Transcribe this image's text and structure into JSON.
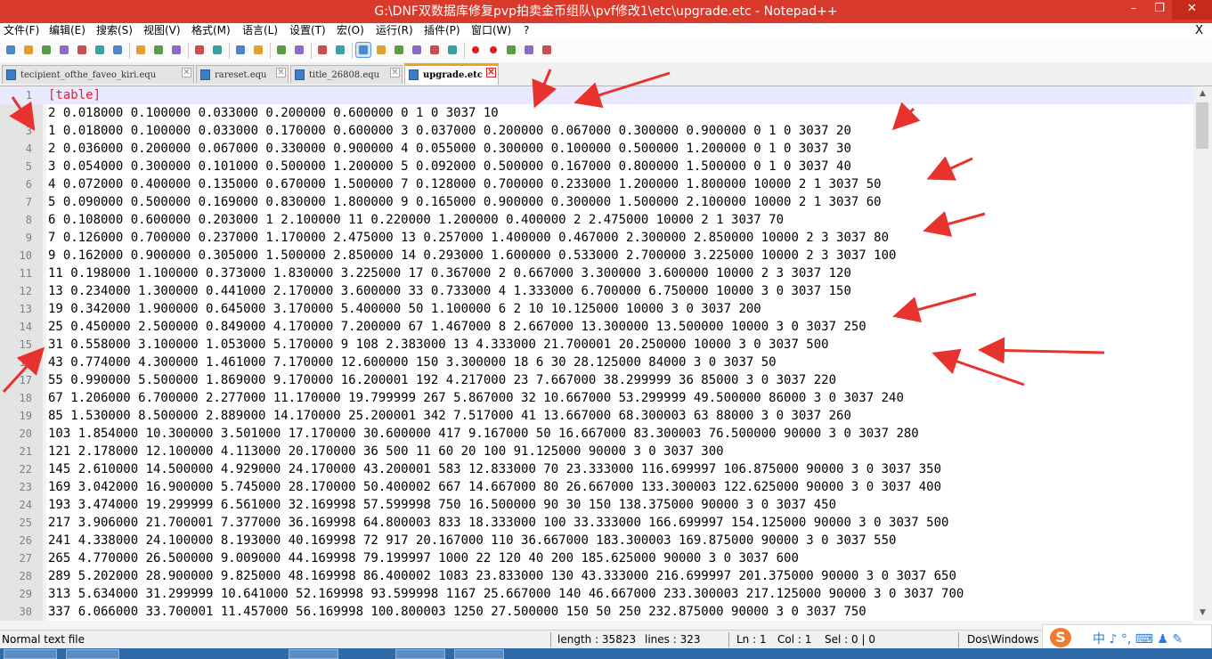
{
  "window": {
    "title": "G:\\DNF双数据库修复pvp拍卖金币组队\\pvf修改1\\etc\\upgrade.etc - Notepad++",
    "minimize_glyph": "–",
    "maximize_glyph": "❐",
    "close_glyph": "✕"
  },
  "menu": {
    "items": [
      "文件(F)",
      "编辑(E)",
      "搜索(S)",
      "视图(V)",
      "格式(M)",
      "语言(L)",
      "设置(T)",
      "宏(O)",
      "运行(R)",
      "插件(P)",
      "窗口(W)",
      "?"
    ],
    "close_glyph": "X"
  },
  "toolbar": {
    "icons": [
      "new-file-icon",
      "open-file-icon",
      "save-icon",
      "save-all-icon",
      "close-icon",
      "close-all-icon",
      "print-icon",
      "cut-icon",
      "copy-icon",
      "paste-icon",
      "undo-icon",
      "redo-icon",
      "find-icon",
      "replace-icon",
      "zoom-in-icon",
      "zoom-out-icon",
      "sync-vertical-icon",
      "sync-horizontal-icon",
      "word-wrap-icon",
      "show-all-chars-icon",
      "indent-guide-icon",
      "doc-map-icon",
      "function-list-icon",
      "folder-workspace-icon",
      "record-macro-icon",
      "stop-record-icon",
      "play-macro-icon",
      "run-macro-multiple-icon",
      "save-macro-icon"
    ]
  },
  "tabs": [
    {
      "label": "tecipient_ofthe_faveo_kiri.equ",
      "active": false
    },
    {
      "label": "rareset.equ",
      "active": false
    },
    {
      "label": "title_26808.equ",
      "active": false
    },
    {
      "label": "upgrade.etc",
      "active": true
    }
  ],
  "editor": {
    "lines": [
      {
        "n": "1",
        "text": "[table]",
        "section": true
      },
      {
        "n": "2",
        "text": "2 0.018000 0.100000 0.033000 0.200000 0.600000 0 1 0 3037 10"
      },
      {
        "n": "3",
        "text": "1 0.018000 0.100000 0.033000 0.170000 0.600000 3 0.037000 0.200000 0.067000 0.300000 0.900000 0 1 0 3037 20"
      },
      {
        "n": "4",
        "text": "2 0.036000 0.200000 0.067000 0.330000 0.900000 4 0.055000 0.300000 0.100000 0.500000 1.200000 0 1 0 3037 30"
      },
      {
        "n": "5",
        "text": "3 0.054000 0.300000 0.101000 0.500000 1.200000 5 0.092000 0.500000 0.167000 0.800000 1.500000 0 1 0 3037 40"
      },
      {
        "n": "6",
        "text": "4 0.072000 0.400000 0.135000 0.670000 1.500000 7 0.128000 0.700000 0.233000 1.200000 1.800000 10000 2 1 3037 50"
      },
      {
        "n": "7",
        "text": "5 0.090000 0.500000 0.169000 0.830000 1.800000 9 0.165000 0.900000 0.300000 1.500000 2.100000 10000 2 1 3037 60"
      },
      {
        "n": "8",
        "text": "6 0.108000 0.600000 0.203000 1 2.100000 11 0.220000 1.200000 0.400000 2 2.475000 10000 2 1 3037 70"
      },
      {
        "n": "9",
        "text": "7 0.126000 0.700000 0.237000 1.170000 2.475000 13 0.257000 1.400000 0.467000 2.300000 2.850000 10000 2 3 3037 80"
      },
      {
        "n": "10",
        "text": "9 0.162000 0.900000 0.305000 1.500000 2.850000 14 0.293000 1.600000 0.533000 2.700000 3.225000 10000 2 3 3037 100"
      },
      {
        "n": "11",
        "text": "11 0.198000 1.100000 0.373000 1.830000 3.225000 17 0.367000 2 0.667000 3.300000 3.600000 10000 2 3 3037 120"
      },
      {
        "n": "12",
        "text": "13 0.234000 1.300000 0.441000 2.170000 3.600000 33 0.733000 4 1.333000 6.700000 6.750000 10000 3 0 3037 150"
      },
      {
        "n": "13",
        "text": "19 0.342000 1.900000 0.645000 3.170000 5.400000 50 1.100000 6 2 10 10.125000 10000 3 0 3037 200"
      },
      {
        "n": "14",
        "text": "25 0.450000 2.500000 0.849000 4.170000 7.200000 67 1.467000 8 2.667000 13.300000 13.500000 10000 3 0 3037 250"
      },
      {
        "n": "15",
        "text": "31 0.558000 3.100000 1.053000 5.170000 9 108 2.383000 13 4.333000 21.700001 20.250000 10000 3 0 3037 500"
      },
      {
        "n": "16",
        "text": "43 0.774000 4.300000 1.461000 7.170000 12.600000 150 3.300000 18 6 30 28.125000 84000 3 0 3037 50"
      },
      {
        "n": "17",
        "text": "55 0.990000 5.500000 1.869000 9.170000 16.200001 192 4.217000 23 7.667000 38.299999 36 85000 3 0 3037 220"
      },
      {
        "n": "18",
        "text": "67 1.206000 6.700000 2.277000 11.170000 19.799999 267 5.867000 32 10.667000 53.299999 49.500000 86000 3 0 3037 240"
      },
      {
        "n": "19",
        "text": "85 1.530000 8.500000 2.889000 14.170000 25.200001 342 7.517000 41 13.667000 68.300003 63 88000 3 0 3037 260"
      },
      {
        "n": "20",
        "text": "103 1.854000 10.300000 3.501000 17.170000 30.600000 417 9.167000 50 16.667000 83.300003 76.500000 90000 3 0 3037 280"
      },
      {
        "n": "21",
        "text": "121 2.178000 12.100000 4.113000 20.170000 36 500 11 60 20 100 91.125000 90000 3 0 3037 300"
      },
      {
        "n": "22",
        "text": "145 2.610000 14.500000 4.929000 24.170000 43.200001 583 12.833000 70 23.333000 116.699997 106.875000 90000 3 0 3037 350"
      },
      {
        "n": "23",
        "text": "169 3.042000 16.900000 5.745000 28.170000 50.400002 667 14.667000 80 26.667000 133.300003 122.625000 90000 3 0 3037 400"
      },
      {
        "n": "24",
        "text": "193 3.474000 19.299999 6.561000 32.169998 57.599998 750 16.500000 90 30 150 138.375000 90000 3 0 3037 450"
      },
      {
        "n": "25",
        "text": "217 3.906000 21.700001 7.377000 36.169998 64.800003 833 18.333000 100 33.333000 166.699997 154.125000 90000 3 0 3037 500"
      },
      {
        "n": "26",
        "text": "241 4.338000 24.100000 8.193000 40.169998 72 917 20.167000 110 36.667000 183.300003 169.875000 90000 3 0 3037 550"
      },
      {
        "n": "27",
        "text": "265 4.770000 26.500000 9.009000 44.169998 79.199997 1000 22 120 40 200 185.625000 90000 3 0 3037 600"
      },
      {
        "n": "28",
        "text": "289 5.202000 28.900000 9.825000 48.169998 86.400002 1083 23.833000 130 43.333000 216.699997 201.375000 90000 3 0 3037 650"
      },
      {
        "n": "29",
        "text": "313 5.634000 31.299999 10.641000 52.169998 93.599998 1167 25.667000 140 46.667000 233.300003 217.125000 90000 3 0 3037 700"
      },
      {
        "n": "30",
        "text": "337 6.066000 33.700001 11.457000 56.169998 100.800003 1250 27.500000 150 50 250 232.875000 90000 3 0 3037 750"
      }
    ]
  },
  "scrollbar": {
    "up_glyph": "▲",
    "down_glyph": "▼"
  },
  "status": {
    "file_type": "Normal text file",
    "length": "length : 35823",
    "lines": "lines : 323",
    "ln": "Ln : 1",
    "col": "Col : 1",
    "sel": "Sel : 0 | 0",
    "eol": "Dos\\Windows"
  },
  "ime": {
    "logo": "S",
    "label": "中 ♪ °, ⌨ ♟ ✎"
  },
  "colors": {
    "titlebar": "#d93a2b",
    "active_tab_accent": "#f2a11a",
    "section_text": "#e3232b",
    "annotation_arrow": "#e8322d"
  }
}
